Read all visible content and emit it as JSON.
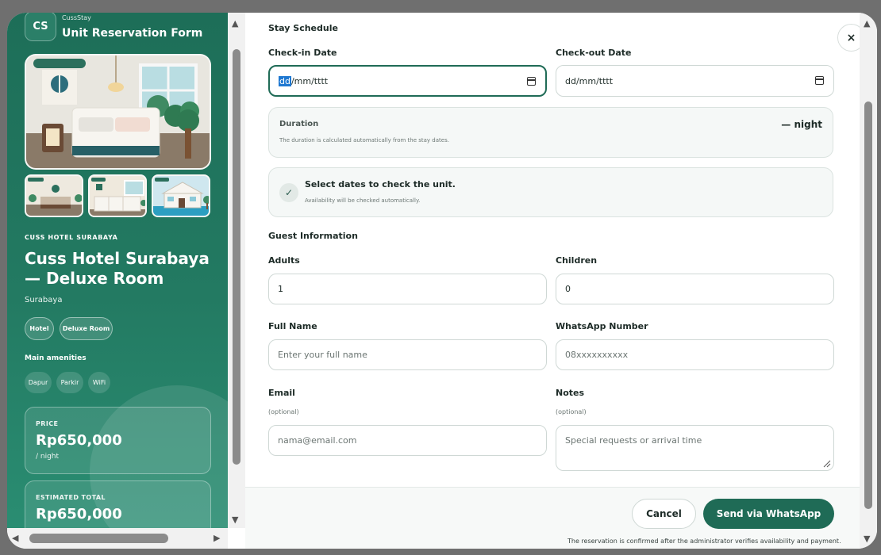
{
  "sidebar": {
    "logo_initials": "CS",
    "brand": "CussStay",
    "form_title": "Unit Reservation Form",
    "eyebrow": "CUSS HOTEL SURABAYA",
    "hotel_name": "Cuss Hotel Surabaya — Deluxe Room",
    "city": "Surabaya",
    "tags": [
      "Hotel",
      "Deluxe Room"
    ],
    "amenities_title": "Main amenities",
    "amenities": [
      "Dapur",
      "Parkir",
      "WiFi"
    ],
    "price_label": "PRICE",
    "price_value": "Rp650,000",
    "price_unit": "/ night",
    "total_label": "ESTIMATED TOTAL",
    "total_value": "Rp650,000"
  },
  "form": {
    "stay_section": "Stay Schedule",
    "checkin_label": "Check-in Date",
    "checkin_day": "dd",
    "checkin_rest": "/mm/tttt",
    "checkout_label": "Check-out Date",
    "checkout_value": "dd/mm/tttt",
    "duration_label": "Duration",
    "duration_value": "— night",
    "duration_hint": "The duration is calculated automatically from the stay dates.",
    "availability_title": "Select dates to check the unit.",
    "availability_hint": "Availability will be checked automatically.",
    "guest_section": "Guest Information",
    "adults_label": "Adults",
    "adults_value": "1",
    "children_label": "Children",
    "children_value": "0",
    "fullname_label": "Full Name",
    "fullname_placeholder": "Enter your full name",
    "whatsapp_label": "WhatsApp Number",
    "whatsapp_placeholder": "08xxxxxxxxxx",
    "email_label": "Email",
    "email_optional": "(optional)",
    "email_placeholder": "nama@email.com",
    "notes_label": "Notes",
    "notes_optional": "(optional)",
    "notes_placeholder": "Special requests or arrival time"
  },
  "footer": {
    "cancel_label": "Cancel",
    "send_label": "Send via WhatsApp",
    "note": "The reservation is confirmed after the administrator verifies availability and payment."
  },
  "icons": {
    "close": "×",
    "check": "✓",
    "arrow_up": "▲",
    "arrow_down": "▼",
    "arrow_left": "◀",
    "arrow_right": "▶"
  },
  "colors": {
    "brand_green": "#1f6b56",
    "panel_green": "#237a62"
  }
}
